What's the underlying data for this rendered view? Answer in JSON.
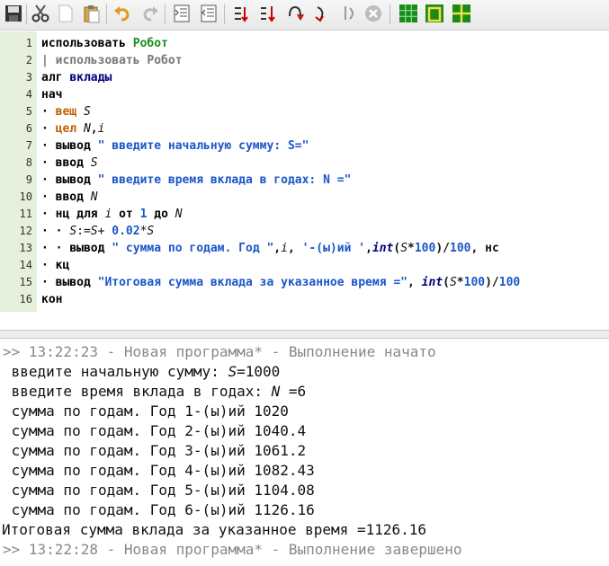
{
  "toolbar": {
    "buttons": [
      "save-icon",
      "cut-icon",
      "new-file-icon",
      "paste-icon",
      "undo-icon",
      "redo-icon",
      "indent-icon",
      "unindent-icon",
      "run-icon",
      "step-into-icon",
      "step-over-icon",
      "step-out-icon",
      "step-back-icon",
      "stop-icon",
      "grid-icon",
      "frame-icon",
      "field-icon"
    ]
  },
  "editor": {
    "lines": [
      {
        "n": "1"
      },
      {
        "n": "2"
      },
      {
        "n": "3"
      },
      {
        "n": "4"
      },
      {
        "n": "5"
      },
      {
        "n": "6"
      },
      {
        "n": "7"
      },
      {
        "n": "8"
      },
      {
        "n": "9"
      },
      {
        "n": "10"
      },
      {
        "n": "11"
      },
      {
        "n": "12"
      },
      {
        "n": "13"
      },
      {
        "n": "14"
      },
      {
        "n": "15"
      },
      {
        "n": "16"
      }
    ],
    "t": {
      "l1a": "использовать",
      "l1b": "Робот",
      "l2": "| использовать Робот",
      "l3a": "алг",
      "l3b": "вклады",
      "l4": "нач",
      "l5a": "вещ",
      "l5b": "S",
      "l6a": "цел",
      "l6b": "N",
      ",": ",",
      "l6c": "i",
      "l7a": "вывод",
      "l7b": "\" введите начальную сумму: S=\"",
      "l8a": "ввод",
      "l8b": "S",
      "l9a": "вывод",
      "l9b": "\" введите время вклада в годах: N =\"",
      "l10a": "ввод",
      "l10b": "N",
      "l11a": "нц для",
      "l11b": "i",
      "l11c": "от",
      "l11d": "1",
      "l11e": "до",
      "l11f": "N",
      "l12a": "S",
      "l12b": ":=",
      "l12c": "S",
      "l12d": "+ ",
      "l12e": "0.02",
      "l12f": "*",
      "l12g": "S",
      "l13a": "вывод",
      "l13b": "\" сумма по годам. Год \"",
      "l13c": ",",
      "l13d": "i",
      "l13e": ",",
      "l13f": "'-(ы)ий '",
      "l13g": ",",
      "l13h": "int",
      "l13i": "(",
      "l13j": "S",
      "l13k": "*",
      "l13l": "100",
      "l13m": ")/",
      "l13n": "100",
      "l13o": ", нс",
      "l14": "кц",
      "l15a": "вывод",
      "l15b": "\"Итоговая сумма вклада за указанное время =\"",
      "l15c": ", ",
      "l15d": "int",
      "l15e": "(",
      "l15f": "S",
      "l15g": "*",
      "l15h": "100",
      "l15i": ")/",
      "l15j": "100",
      "l16": "кон"
    }
  },
  "output": {
    "start": ">> 13:22:23 - Новая программа* - Выполнение начато",
    "in1a": " введите начальную сумму: ",
    "in1b": "S",
    "in1c": "=1000",
    "in2a": " введите время вклада в годах: ",
    "in2b": "N",
    "in2c": " =6",
    "rows": [
      " сумма по годам. Год 1-(ы)ий 1020",
      " сумма по годам. Год 2-(ы)ий 1040.4",
      " сумма по годам. Год 3-(ы)ий 1061.2",
      " сумма по годам. Год 4-(ы)ий 1082.43",
      " сумма по годам. Год 5-(ы)ий 1104.08",
      " сумма по годам. Год 6-(ы)ий 1126.16"
    ],
    "total": "Итоговая сумма вклада за указанное время =1126.16",
    "end": ">> 13:22:28 - Новая программа* - Выполнение завершено"
  }
}
